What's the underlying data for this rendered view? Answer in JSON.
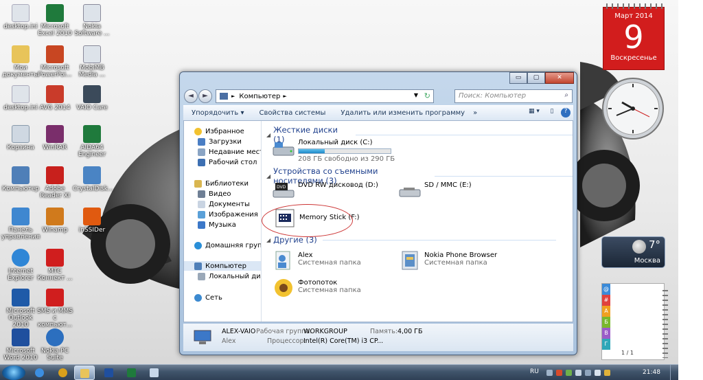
{
  "desktop": {
    "icons": [
      {
        "label": "desktop.ini",
        "icon": "settings-file-icon",
        "color": "#dfe4ea"
      },
      {
        "label": "Microsoft Excel 2010",
        "icon": "excel-icon",
        "color": "#1f7a3c"
      },
      {
        "label": "Nokia Software ...",
        "icon": "nokia-software-icon",
        "color": "#dde3ea"
      },
      {
        "label": "Мои документы",
        "icon": "folder-icon",
        "color": "#e8c45a"
      },
      {
        "label": "Microsoft PowerPoi...",
        "icon": "powerpoint-icon",
        "color": "#c84622"
      },
      {
        "label": "MobiMB Media ...",
        "icon": "mobimb-icon",
        "color": "#dde3ea"
      },
      {
        "label": "desktop.ini",
        "icon": "settings-file-icon",
        "color": "#dfe4ea"
      },
      {
        "label": "AVG 2014",
        "icon": "avg-icon",
        "color": "#c93b2a"
      },
      {
        "label": "VAIO Care",
        "icon": "vaio-care-icon",
        "color": "#3b4a5a"
      },
      {
        "label": "Корзина",
        "icon": "recycle-bin-icon",
        "color": "#cfd8e2"
      },
      {
        "label": "WinRAR",
        "icon": "winrar-icon",
        "color": "#7a2e6b"
      },
      {
        "label": "AIDA64 Engineer",
        "icon": "aida64-icon",
        "color": "#1f7a3c"
      },
      {
        "label": "Компьютер",
        "icon": "computer-icon",
        "color": "#4f7fb8"
      },
      {
        "label": "Adobe Reader XI",
        "icon": "adobe-reader-icon",
        "color": "#c8201c"
      },
      {
        "label": "CrystalDisk...",
        "icon": "crystaldisk-icon",
        "color": "#4a84c4"
      },
      {
        "label": "Панель управления",
        "icon": "control-panel-icon",
        "color": "#3f87d0"
      },
      {
        "label": "Winamp",
        "icon": "winamp-icon",
        "color": "#d07a1c"
      },
      {
        "label": "inSSIDer",
        "icon": "inssider-icon",
        "color": "#e05a10"
      },
      {
        "label": "Internet Explorer",
        "icon": "internet-explorer-icon",
        "color": "#2f86d6"
      },
      {
        "label": "МТС Коннект ...",
        "icon": "mts-connect-icon",
        "color": "#d01e1e"
      },
      {
        "label": "Microsoft Outlook 2010",
        "icon": "outlook-icon",
        "color": "#1f5aa8"
      },
      {
        "label": "SMS и MMS с компьют...",
        "icon": "sms-mms-icon",
        "color": "#d01e1e"
      },
      {
        "label": "Microsoft Word 2010",
        "icon": "word-icon",
        "color": "#1f4f9e"
      },
      {
        "label": "Nokia PC Suite",
        "icon": "nokia-pc-suite-icon",
        "color": "#2c6fbf"
      }
    ]
  },
  "gadgets": {
    "calendar": {
      "month": "Март 2014",
      "day": "9",
      "weekday": "Воскресенье"
    },
    "weather": {
      "temp": "7°",
      "city": "Москва"
    },
    "notes": {
      "page": "1 / 1",
      "tabs": [
        "@",
        "#",
        "A",
        "Б",
        "В",
        "Г"
      ],
      "tab_colors": [
        "#3a8ad8",
        "#e0413d",
        "#f0a020",
        "#79b82c",
        "#9b5cc8",
        "#2fa7b8"
      ]
    }
  },
  "explorer": {
    "controls": {
      "minimize": "▭",
      "maximize": "▢",
      "close": "✕"
    },
    "nav": {
      "back": "◄",
      "forward": "►"
    },
    "address": {
      "root_chevron": "►",
      "path": "Компьютер",
      "chevron": "►",
      "dropdown": "▼",
      "refresh": "↻"
    },
    "search": {
      "placeholder": "Поиск: Компьютер",
      "icon": "⌕"
    },
    "toolbar": {
      "organize": "Упорядочить ▾",
      "system_props": "Свойства системы",
      "uninstall": "Удалить или изменить программу",
      "more": "»",
      "view": "▦ ▾",
      "preview": "▯",
      "help": "?"
    },
    "nav_pane": {
      "favorites": "Избранное",
      "downloads": "Загрузки",
      "recent": "Недавние места",
      "desktop": "Рабочий стол",
      "libraries": "Библиотеки",
      "video": "Видео",
      "documents": "Документы",
      "images": "Изображения",
      "music": "Музыка",
      "homegroup": "Домашняя группа",
      "computer": "Компьютер",
      "local_disk": "Локальный диск (C",
      "network": "Сеть"
    },
    "groups": {
      "hard_disks": {
        "title": "Жесткие диски (1)"
      },
      "removable": {
        "title": "Устройства со съемными носителями (3)"
      },
      "other": {
        "title": "Другие (3)"
      }
    },
    "items": {
      "local_disk": {
        "name": "Локальный диск (C:)",
        "free": "208 ГБ свободно из 290 ГБ",
        "used_fraction": 0.28
      },
      "dvd": {
        "name": "DVD RW дисковод (D:)",
        "badge": "DVD"
      },
      "sd": {
        "name": "SD / MMC (E:)"
      },
      "memory_stick": {
        "name": "Memory Stick (F:)"
      },
      "alex": {
        "name": "Alex",
        "type": "Системная папка"
      },
      "nokia": {
        "name": "Nokia Phone Browser",
        "type": "Системная папка"
      },
      "photostream": {
        "name": "Фотопоток",
        "type": "Системная папка"
      }
    },
    "status": {
      "computer_name": "ALEX-VAIO",
      "workgroup_label": "Рабочая группа:",
      "workgroup": "WORKGROUP",
      "memory_label": "Память:",
      "memory": "4,00 ГБ",
      "user": "Alex",
      "cpu_label": "Процессор:",
      "cpu": "Intel(R) Core(TM) i3 CP..."
    }
  },
  "taskbar": {
    "apps": [
      {
        "name": "internet-explorer",
        "color": "#3c8ee0"
      },
      {
        "name": "opera",
        "color": "#d8a01c"
      },
      {
        "name": "explorer",
        "color": "#e8c45a"
      },
      {
        "name": "word",
        "color": "#1f4f9e"
      },
      {
        "name": "excel",
        "color": "#1f7a3c"
      },
      {
        "name": "notepad",
        "color": "#c8d8ea"
      }
    ],
    "tray": {
      "lang": "RU",
      "time": "21:48"
    }
  },
  "colors": {
    "group_heading": "#1e3f8c",
    "annotation": "#cc3333",
    "calendar": "#d21d1d"
  }
}
